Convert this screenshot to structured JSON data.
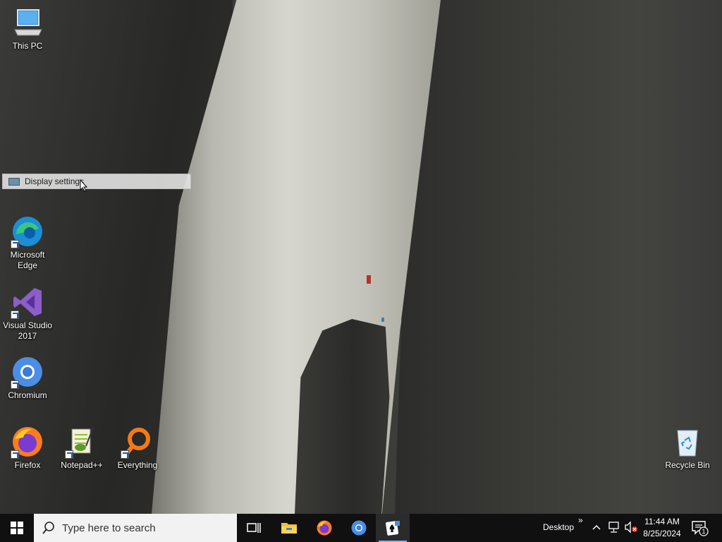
{
  "desktop": {
    "icons": [
      {
        "label": "This PC",
        "icon": "computer-icon"
      },
      {
        "label": "Microsoft Edge",
        "icon": "edge-icon"
      },
      {
        "label": "Visual Studio 2017",
        "icon": "visual-studio-icon"
      },
      {
        "label": "Chromium",
        "icon": "chromium-icon"
      },
      {
        "label": "Firefox",
        "icon": "firefox-icon"
      },
      {
        "label": "Notepad++",
        "icon": "notepadpp-icon"
      },
      {
        "label": "Everything",
        "icon": "everything-icon"
      },
      {
        "label": "Recycle Bin",
        "icon": "recycle-bin-icon"
      }
    ],
    "tooltip": {
      "text": "Display settings",
      "icon": "display-icon"
    }
  },
  "taskbar": {
    "search_placeholder": "Type here to search",
    "pinned": [
      "task-view-icon",
      "file-explorer-icon",
      "firefox-icon",
      "chromium-icon",
      "solitaire-icon"
    ],
    "active_app": "solitaire-icon",
    "desktop_toolbar_label": "Desktop",
    "desktop_toolbar_chevron": "»",
    "clock": {
      "time": "11:44 AM",
      "date": "8/25/2024"
    },
    "notifications_count": "1",
    "colors": {
      "taskbar": "#101010",
      "search_box": "#f2f2f2",
      "active_underline": "#7ab8f5"
    }
  }
}
